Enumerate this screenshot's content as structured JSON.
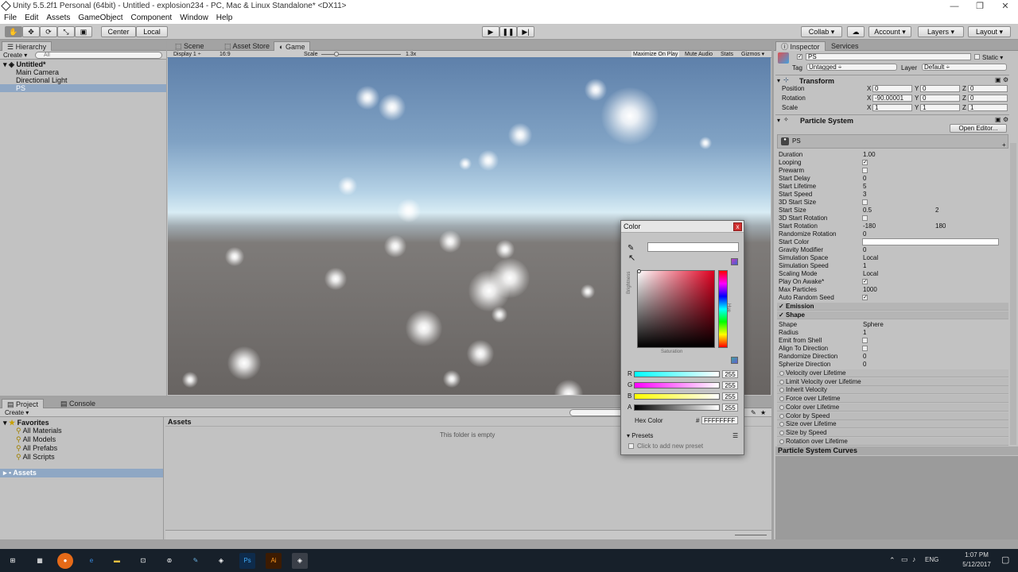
{
  "window": {
    "title": "Unity 5.5.2f1 Personal (64bit) - Untitled - explosion234 - PC, Mac & Linux Standalone* <DX11>",
    "minimize": "—",
    "restore": "❐",
    "close": "✕"
  },
  "menu": [
    "File",
    "Edit",
    "Assets",
    "GameObject",
    "Component",
    "Window",
    "Help"
  ],
  "toolbar": {
    "center": "Center",
    "local": "Local",
    "collab": "Collab ▾",
    "account": "Account ▾",
    "layers": "Layers ▾",
    "layout": "Layout ▾"
  },
  "hierarchy": {
    "tab": "Hierarchy",
    "create": "Create ▾",
    "search_placeholder": "All",
    "scene": "Untitled*",
    "items": [
      "Main Camera",
      "Directional Light",
      "PS"
    ]
  },
  "scene_tabs": [
    "Scene",
    "Asset Store",
    "Game"
  ],
  "game": {
    "display": "Display 1 ÷",
    "aspect": "16:9",
    "scale_label": "Scale",
    "scale_value": "1.3x",
    "maximize": "Maximize On Play",
    "mute": "Mute Audio",
    "stats": "Stats",
    "gizmos": "Gizmos ▾"
  },
  "project": {
    "tab_project": "Project",
    "tab_console": "Console",
    "create": "Create ▾",
    "favorites": "Favorites",
    "favorite_items": [
      "All Materials",
      "All Models",
      "All Prefabs",
      "All Scripts"
    ],
    "assets_root": "Assets",
    "assets_header": "Assets",
    "empty": "This folder is empty"
  },
  "inspector": {
    "tab": "Inspector",
    "tab2": "Services",
    "object_name": "PS",
    "static": "Static ▾",
    "tag_label": "Tag",
    "tag_value": "Untagged ÷",
    "layer_label": "Layer",
    "layer_value": "Default ÷",
    "transform": {
      "title": "Transform",
      "rows": [
        {
          "label": "Position",
          "x": "0",
          "y": "0",
          "z": "0"
        },
        {
          "label": "Rotation",
          "x": "-90.00001",
          "y": "0",
          "z": "0"
        },
        {
          "label": "Scale",
          "x": "1",
          "y": "1",
          "z": "1"
        }
      ]
    },
    "ps_title": "Particle System",
    "open_editor": "Open Editor...",
    "ps_module": "PS",
    "props": [
      {
        "label": "Duration",
        "value": "1.00"
      },
      {
        "label": "Looping",
        "check": "✓"
      },
      {
        "label": "Prewarm",
        "check": ""
      },
      {
        "label": "Start Delay",
        "value": "0"
      },
      {
        "label": "Start Lifetime",
        "value": "5"
      },
      {
        "label": "Start Speed",
        "value": "3"
      },
      {
        "label": "3D Start Size",
        "check": ""
      },
      {
        "label": "Start Size",
        "value": "0.5",
        "value2": "2"
      },
      {
        "label": "3D Start Rotation",
        "check": ""
      },
      {
        "label": "Start Rotation",
        "value": "-180",
        "value2": "180"
      },
      {
        "label": "Randomize Rotation",
        "value": "0"
      },
      {
        "label": "Start Color",
        "value": ""
      },
      {
        "label": "Gravity Modifier",
        "value": "0"
      },
      {
        "label": "Simulation Space",
        "value": "Local"
      },
      {
        "label": "Simulation Speed",
        "value": "1"
      },
      {
        "label": "Scaling Mode",
        "value": "Local"
      },
      {
        "label": "Play On Awake*",
        "check": "✓"
      },
      {
        "label": "Max Particles",
        "value": "1000"
      },
      {
        "label": "Auto Random Seed",
        "check": "✓"
      }
    ],
    "emission": "Emission",
    "shape": "Shape",
    "shape_props": [
      {
        "label": "Shape",
        "value": "Sphere"
      },
      {
        "label": "Radius",
        "value": "1"
      },
      {
        "label": "Emit from Shell",
        "check": ""
      },
      {
        "label": "Align To Direction",
        "check": ""
      },
      {
        "label": "Randomize Direction",
        "value": "0"
      },
      {
        "label": "Spherize Direction",
        "value": "0"
      }
    ],
    "modules": [
      "Velocity over Lifetime",
      "Limit Velocity over Lifetime",
      "Inherit Velocity",
      "Force over Lifetime",
      "Color over Lifetime",
      "Color by Speed",
      "Size over Lifetime",
      "Size by Speed",
      "Rotation over Lifetime"
    ],
    "curves": "Particle System Curves"
  },
  "color_picker": {
    "title": "Color",
    "close": "x",
    "brightness": "Brightness",
    "saturation": "Saturation",
    "hue": "Hue",
    "channels": [
      {
        "name": "R",
        "value": "255"
      },
      {
        "name": "G",
        "value": "255"
      },
      {
        "name": "B",
        "value": "255"
      },
      {
        "name": "A",
        "value": "255"
      }
    ],
    "hex_label": "Hex Color",
    "hex_prefix": "#",
    "hex_value": "FFFFFFFF",
    "presets": "Presets",
    "add_preset": "Click to add new preset"
  },
  "taskbar": {
    "time": "1:07 PM",
    "date": "5/12/2017",
    "lang": "ENG"
  },
  "colors": {
    "sky_top": "#5e80aa",
    "ground": "#686462",
    "selection": "#8fa7c4",
    "panel": "#c2c2c2"
  }
}
